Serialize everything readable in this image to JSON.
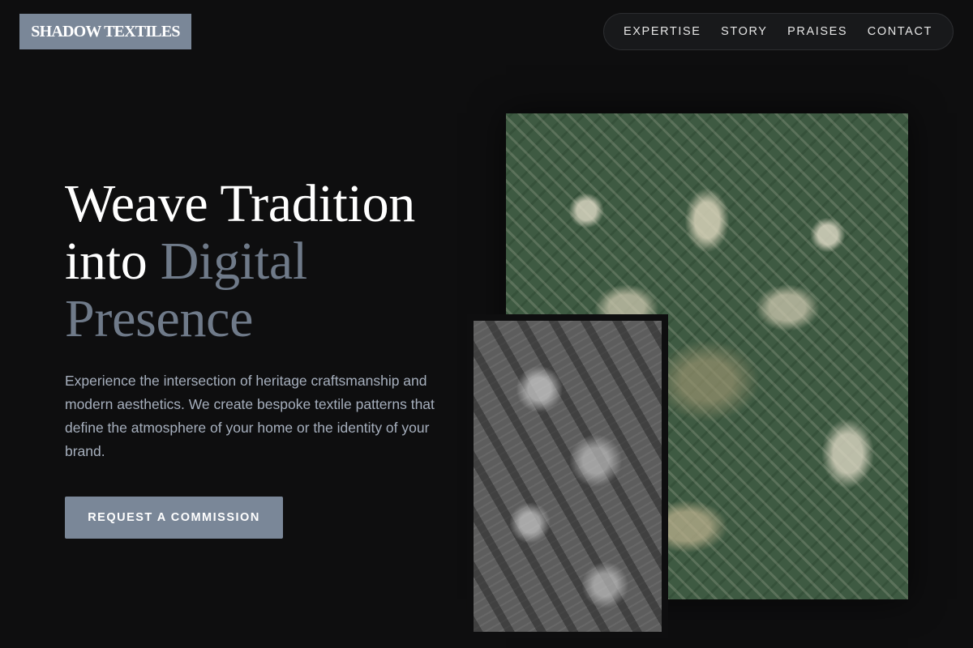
{
  "brand": {
    "logo_text": "SHADOW TEXTILES"
  },
  "nav": {
    "items": [
      {
        "label": "EXPERTISE"
      },
      {
        "label": "STORY"
      },
      {
        "label": "PRAISES"
      },
      {
        "label": "CONTACT"
      }
    ]
  },
  "hero": {
    "headline_line1": "Weave Tradition",
    "headline_line2_plain": "into",
    "headline_line2_accent": "Digital",
    "headline_line3_accent": "Presence",
    "subtitle": "Experience the intersection of heritage craftsmanship and modern aesthetics. We create bespoke textile patterns that define the atmosphere of your home or the identity of your brand.",
    "cta_label": "REQUEST A COMMISSION"
  },
  "colors": {
    "background": "#0e0e0f",
    "accent": "#7a8798",
    "accent_text": "#6f7a89",
    "body_text": "#a6afbd"
  }
}
